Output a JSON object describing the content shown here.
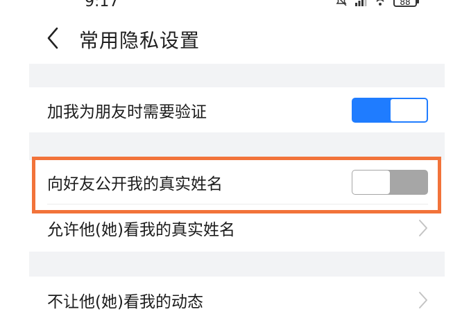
{
  "status_bar": {
    "time": "9:17",
    "battery": "88",
    "icons": [
      "bell-muted-icon",
      "signal-icon",
      "wifi-icon",
      "battery-icon"
    ]
  },
  "header": {
    "back_icon": "chevron-left-icon",
    "title": "常用隐私设置"
  },
  "settings": {
    "friend_verify": {
      "label": "加我为朋友时需要验证",
      "enabled": true
    },
    "public_real_name": {
      "label": "向好友公开我的真实姓名",
      "enabled": false
    },
    "allow_view_name": {
      "label": "允许他(她)看我的真实姓名"
    },
    "hide_moments": {
      "label": "不让他(她)看我的动态"
    }
  },
  "colors": {
    "accent": "#1f7cff",
    "toggle_off": "#a6a6a6",
    "highlight": "#f2733a",
    "section_gap": "#f2f3f5"
  }
}
